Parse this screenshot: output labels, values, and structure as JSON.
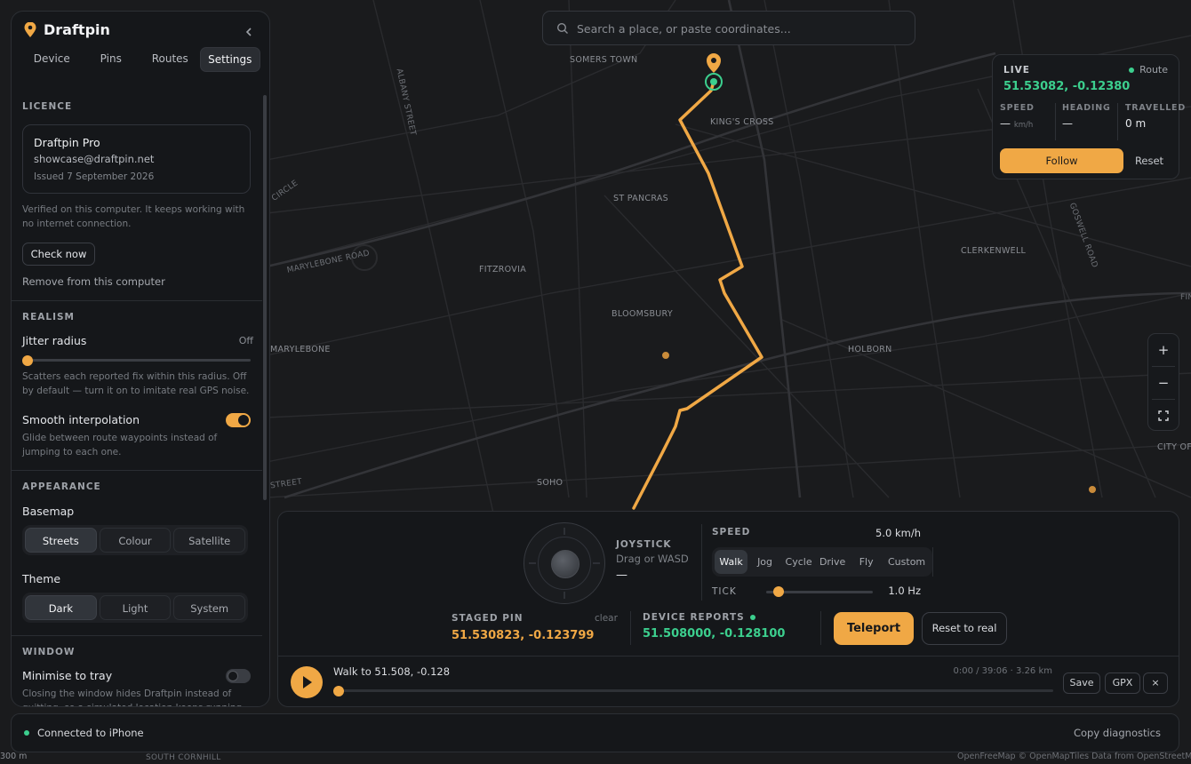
{
  "app": {
    "name": "Draftpin",
    "collapse_icon": "chevron-left-icon",
    "accent_color": "#f0a845",
    "success_color": "#3ccf8e"
  },
  "tabs": [
    {
      "label": "Device",
      "active": false
    },
    {
      "label": "Pins",
      "active": false
    },
    {
      "label": "Routes",
      "active": false
    },
    {
      "label": "Settings",
      "active": true
    }
  ],
  "licence": {
    "section": "LICENCE",
    "plan": "Draftpin Pro",
    "email": "showcase@draftpin.net",
    "issued": "Issued 7 September 2026",
    "note": "Verified on this computer. It keeps working with no internet connection.",
    "check_button": "Check now",
    "remove_link": "Remove from this computer"
  },
  "realism": {
    "section": "REALISM",
    "jitter_label": "Jitter radius",
    "jitter_value": "Off",
    "jitter_level": 0,
    "jitter_note": "Scatters each reported fix within this radius. Off by default — turn it on to imitate real GPS noise.",
    "smooth_label": "Smooth interpolation",
    "smooth_on": true,
    "smooth_note": "Glide between route waypoints instead of jumping to each one."
  },
  "appearance": {
    "section": "APPEARANCE",
    "basemap_label": "Basemap",
    "basemap_options": [
      "Streets",
      "Colour",
      "Satellite"
    ],
    "basemap_selected": "Streets",
    "theme_label": "Theme",
    "theme_options": [
      "Dark",
      "Light",
      "System"
    ],
    "theme_selected": "Dark"
  },
  "window": {
    "section": "WINDOW",
    "tray_label": "Minimise to tray",
    "tray_on": false,
    "tray_note": "Closing the window hides Draftpin instead of quitting, so a simulated location keeps running."
  },
  "search": {
    "placeholder": "Search a place, or paste coordinates..."
  },
  "map": {
    "labels": [
      "SOMERS TOWN",
      "KING'S CROSS",
      "ST PANCRAS",
      "FITZROVIA",
      "BLOOMSBURY",
      "MARYLEBONE",
      "HOLBORN",
      "CLERKENWELL",
      "SOHO",
      "CITY OF",
      "MARYLEBONE ROAD",
      "ALBANY STREET",
      "GOSWELL ROAD",
      "CIRCLE",
      "STREET",
      "FIN",
      "SOUTH CORNHILL"
    ],
    "scale": "300 m",
    "attribution": "OpenFreeMap © OpenMapTiles Data from OpenStreetMap"
  },
  "live": {
    "title": "LIVE",
    "mode": "Route",
    "coords": "51.53082, -0.12380",
    "speed_label": "SPEED",
    "speed_value": "—",
    "speed_unit": "km/h",
    "heading_label": "HEADING",
    "heading_value": "—",
    "travelled_label": "TRAVELLED",
    "travelled_value": "0 m",
    "follow_button": "Follow",
    "reset_button": "Reset"
  },
  "zoom": {
    "zoom_in": "+",
    "zoom_out": "−",
    "fullscreen_icon": "fullscreen-icon"
  },
  "control": {
    "joystick_label": "JOYSTICK",
    "joystick_hint": "Drag or WASD",
    "joystick_value": "—",
    "speed_label": "SPEED",
    "speed_value": "5.0 km/h",
    "speed_modes": [
      "Walk",
      "Jog",
      "Cycle",
      "Drive",
      "Fly",
      "Custom"
    ],
    "speed_selected": "Walk",
    "tick_label": "TICK",
    "tick_value": "1.0 Hz",
    "tick_level": 0.12,
    "staged_label": "STAGED PIN",
    "staged_clear": "clear",
    "staged_value": "51.530823, -0.123799",
    "device_label": "DEVICE REPORTS",
    "device_value": "51.508000, -0.128100",
    "teleport_button": "Teleport",
    "reset_real_button": "Reset to real"
  },
  "playback": {
    "route_name": "Walk to 51.508, -0.128",
    "meta": "0:00 / 39:06 · 3.26 km",
    "progress": 0,
    "save_button": "Save",
    "gpx_button": "GPX",
    "close_label": "×"
  },
  "status": {
    "connection": "Connected to iPhone",
    "copy_button": "Copy diagnostics"
  }
}
